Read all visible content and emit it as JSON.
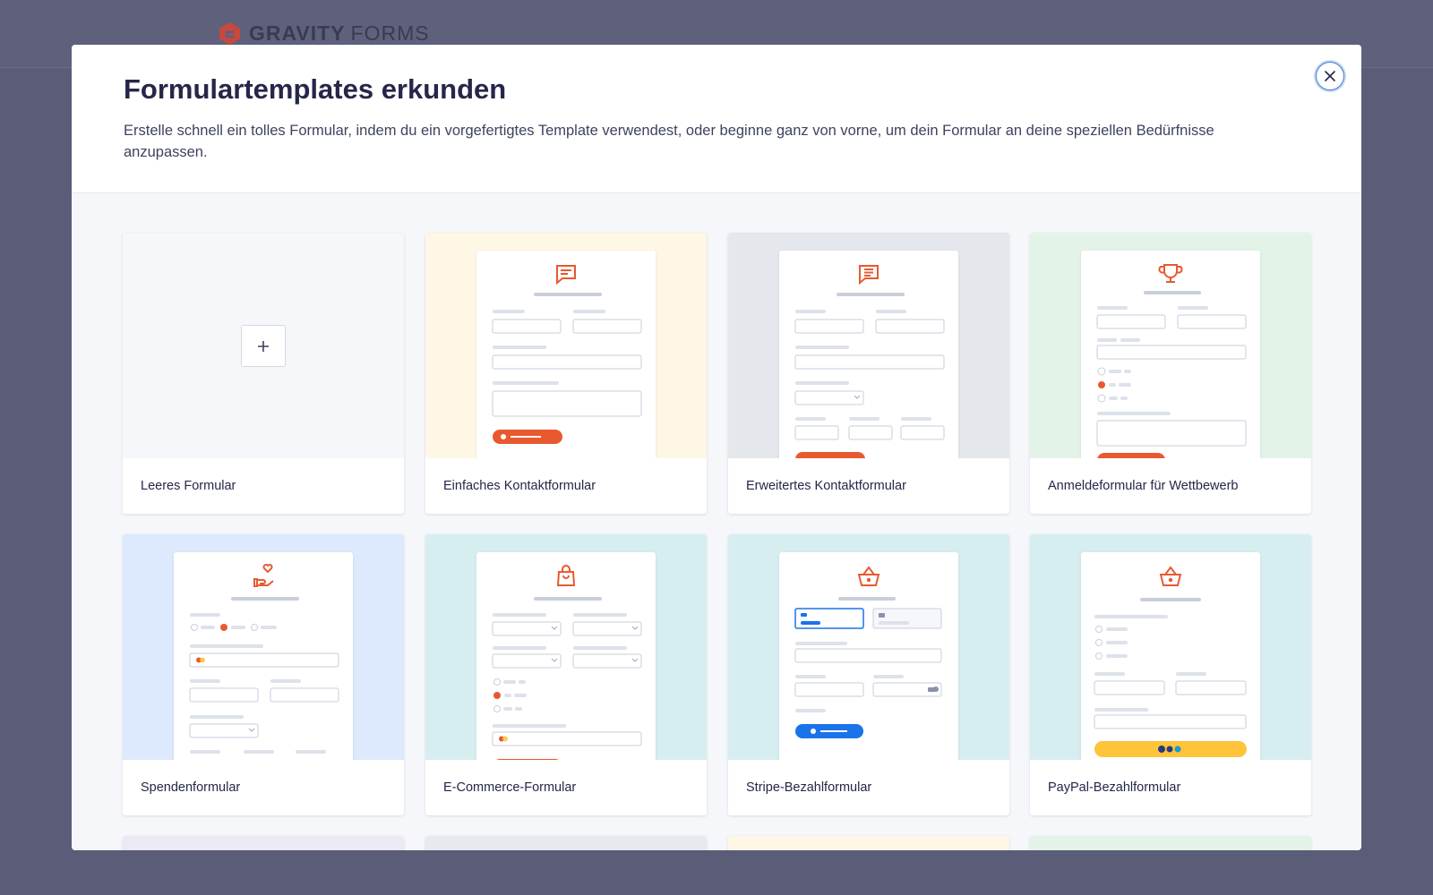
{
  "brand": {
    "bold": "GRAVITY",
    "light": "FORMS",
    "accent": "#e44c2b"
  },
  "modal": {
    "title": "Formulartemplates erkunden",
    "description": "Erstelle schnell ein tolles Formular, indem du ein vorgefertigtes Template verwendest, oder beginne ganz von vorne, um dein Formular an deine speziellen Bedürfnisse anzupassen.",
    "close_icon": "close-icon"
  },
  "templates": [
    {
      "label": "Leeres Formular",
      "bg": "#f5f7fa",
      "icon": "plus-icon"
    },
    {
      "label": "Einfaches Kontaktformular",
      "bg": "#fff7e6",
      "icon": "chat-icon"
    },
    {
      "label": "Erweitertes Kontaktformular",
      "bg": "#e4e8ed",
      "icon": "chat-list-icon"
    },
    {
      "label": "Anmeldeformular für Wettbewerb",
      "bg": "#e3f3e8",
      "icon": "trophy-icon"
    },
    {
      "label": "Spendenformular",
      "bg": "#dde9fc",
      "icon": "heart-hand-icon"
    },
    {
      "label": "E-Commerce-Formular",
      "bg": "#d7eef0",
      "icon": "shopping-bag-icon"
    },
    {
      "label": "Stripe-Bezahlformular",
      "bg": "#d7eef0",
      "icon": "basket-icon"
    },
    {
      "label": "PayPal-Bezahlformular",
      "bg": "#d7eef0",
      "icon": "basket-icon"
    }
  ],
  "partial_row_bgs": [
    "#ece8f4",
    "#e6e9ee",
    "#fff7e6",
    "#e3f3e8"
  ],
  "colors": {
    "accent_orange": "#e8592f",
    "stripe_blue": "#1a73e8",
    "paypal_yellow": "#fec43a"
  }
}
